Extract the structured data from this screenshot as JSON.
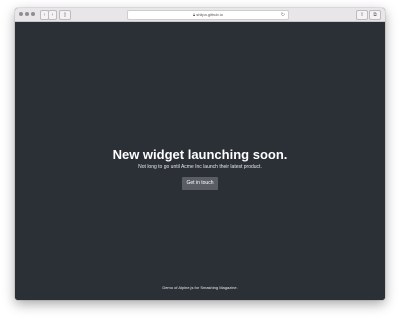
{
  "browser": {
    "url": "shilpa.github.io",
    "back_icon": "chevron-left-icon",
    "forward_icon": "chevron-right-icon",
    "sidebar_icon": "sidebar-icon",
    "reload_icon": "reload-icon",
    "share_icon": "share-icon",
    "tabs_icon": "tabs-icon",
    "lock_icon": "lock-icon"
  },
  "hero": {
    "headline": "New widget launching soon.",
    "subline": "Not long to go until Acme Inc launch their latest product.",
    "cta_label": "Get in touch"
  },
  "footer": {
    "text": "Demo of Alpine.js for Smashing Magazine."
  },
  "colors": {
    "background": "#2b2f36",
    "button": "#5a5e64",
    "text": "#ffffff"
  }
}
